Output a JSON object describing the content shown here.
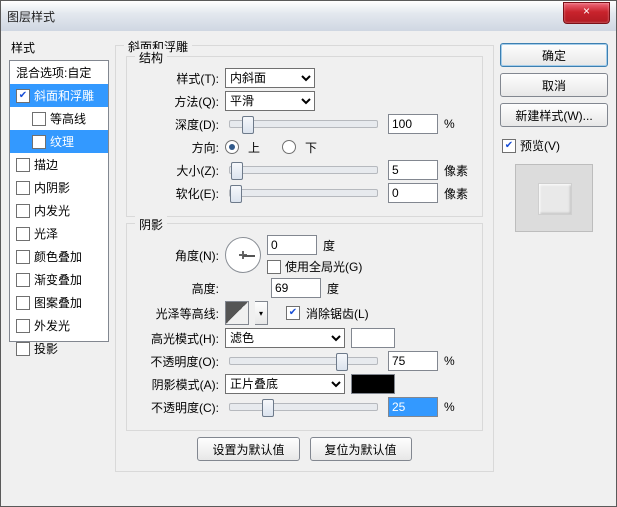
{
  "window": {
    "title": "图层样式"
  },
  "close": {
    "glyph": "×"
  },
  "left": {
    "heading": "样式",
    "items": [
      {
        "label": "混合选项:自定",
        "checked": false,
        "selected": false,
        "noCheck": true
      },
      {
        "label": "斜面和浮雕",
        "checked": true,
        "selected": true
      },
      {
        "label": "等高线",
        "checked": false,
        "selected": false,
        "sub": true
      },
      {
        "label": "纹理",
        "checked": false,
        "selected": false,
        "sub": true,
        "subsel": true
      },
      {
        "label": "描边",
        "checked": false
      },
      {
        "label": "内阴影",
        "checked": false
      },
      {
        "label": "内发光",
        "checked": false
      },
      {
        "label": "光泽",
        "checked": false
      },
      {
        "label": "颜色叠加",
        "checked": false
      },
      {
        "label": "渐变叠加",
        "checked": false
      },
      {
        "label": "图案叠加",
        "checked": false
      },
      {
        "label": "外发光",
        "checked": false
      },
      {
        "label": "投影",
        "checked": false
      }
    ]
  },
  "panel": {
    "title": "斜面和浮雕",
    "structure": {
      "legend": "结构",
      "style_lbl": "样式(T):",
      "style_val": "内斜面",
      "method_lbl": "方法(Q):",
      "method_val": "平滑",
      "depth_lbl": "深度(D):",
      "depth_val": "100",
      "depth_unit": "%",
      "dir_lbl": "方向:",
      "dir_up": "上",
      "dir_down": "下",
      "size_lbl": "大小(Z):",
      "size_val": "5",
      "size_unit": "像素",
      "soften_lbl": "软化(E):",
      "soften_val": "0",
      "soften_unit": "像素"
    },
    "shading": {
      "legend": "阴影",
      "angle_lbl": "角度(N):",
      "angle_val": "0",
      "angle_unit": "度",
      "global_lbl": "使用全局光(G)",
      "alt_lbl": "高度:",
      "alt_val": "69",
      "alt_unit": "度",
      "gloss_lbl": "光泽等高线:",
      "antialias_lbl": "消除锯齿(L)",
      "hi_mode_lbl": "高光模式(H):",
      "hi_mode_val": "滤色",
      "hi_op_lbl": "不透明度(O):",
      "hi_op_val": "75",
      "hi_op_unit": "%",
      "sh_mode_lbl": "阴影模式(A):",
      "sh_mode_val": "正片叠底",
      "sh_op_lbl": "不透明度(C):",
      "sh_op_val": "25",
      "sh_op_unit": "%"
    },
    "btn_default": "设置为默认值",
    "btn_reset": "复位为默认值"
  },
  "right": {
    "ok": "确定",
    "cancel": "取消",
    "newstyle": "新建样式(W)...",
    "preview": "预览(V)"
  },
  "colors": {
    "hi_swatch": "#ffffff",
    "sh_swatch": "#000000"
  }
}
